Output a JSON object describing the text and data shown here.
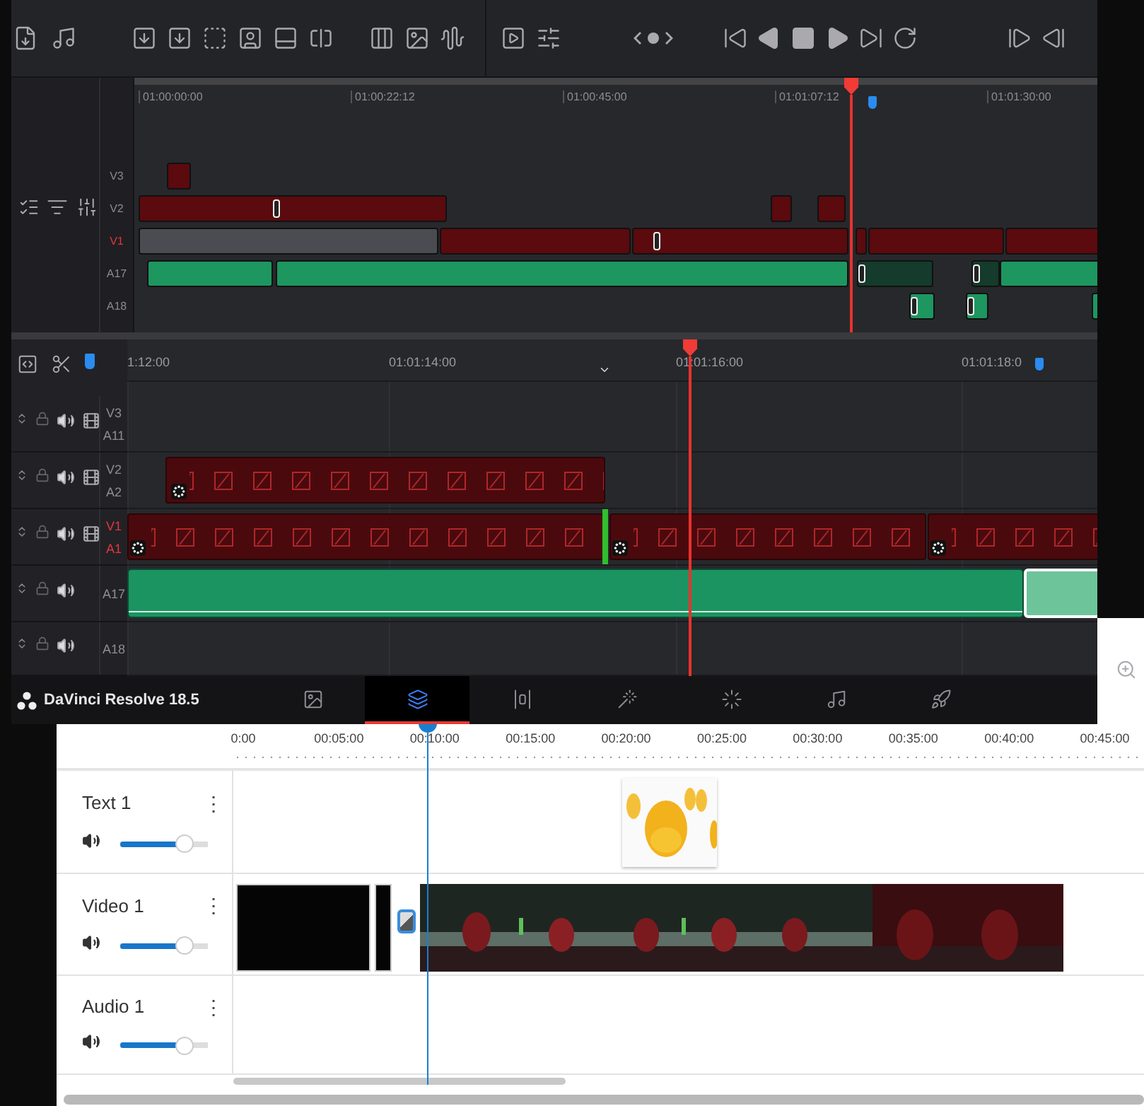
{
  "resolve": {
    "overview": {
      "ruler": [
        "01:00:00:00",
        "01:00:22:12",
        "01:00:45:00",
        "01:01:07:12",
        "01:01:30:00"
      ],
      "tracks": [
        {
          "label": "V3",
          "active": false
        },
        {
          "label": "V2",
          "active": false
        },
        {
          "label": "V1",
          "active": true
        },
        {
          "label": "A17",
          "active": false
        },
        {
          "label": "A18",
          "active": false
        }
      ]
    },
    "timeline": {
      "ruler": [
        "1:12:00",
        "01:01:14:00",
        "01:01:16:00",
        "01:01:18:0"
      ],
      "tracks": [
        {
          "labels": [
            "V3",
            "A11"
          ],
          "kind": "video",
          "active": false
        },
        {
          "labels": [
            "V2",
            "A2"
          ],
          "kind": "video",
          "active": false
        },
        {
          "labels": [
            "V1",
            "A1"
          ],
          "kind": "video",
          "active": true
        },
        {
          "labels": [
            "A17"
          ],
          "kind": "audio",
          "active": false
        },
        {
          "labels": [
            "A18"
          ],
          "kind": "audio",
          "active": false
        }
      ]
    },
    "app_title": "DaVinci Resolve 18.5",
    "page_tabs": [
      {
        "selected": false
      },
      {
        "selected": true
      },
      {
        "selected": false
      },
      {
        "selected": false
      },
      {
        "selected": false
      },
      {
        "selected": false
      },
      {
        "selected": false
      }
    ]
  },
  "web_editor": {
    "ruler": [
      "0:00",
      "00:05:00",
      "00:10:00",
      "00:15:00",
      "00:20:00",
      "00:25:00",
      "00:30:00",
      "00:35:00",
      "00:40:00",
      "00:45:00"
    ],
    "tracks": [
      {
        "name": "Text 1",
        "menu": "⋮",
        "level": 0.72
      },
      {
        "name": "Video 1",
        "menu": "⋮",
        "level": 0.72
      },
      {
        "name": "Audio 1",
        "menu": "⋮",
        "level": 0.72
      }
    ]
  }
}
